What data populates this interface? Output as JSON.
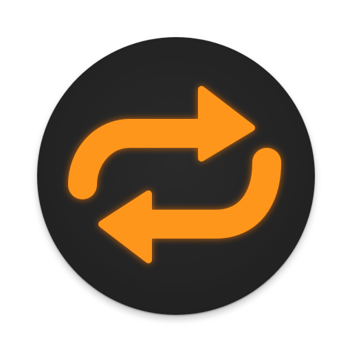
{
  "app": {
    "name": "repeat-button"
  },
  "button": {
    "icon": "repeat-icon",
    "colors": {
      "background": "#242424",
      "glyph": "#ff961f",
      "glow": "#ff7a00"
    }
  }
}
